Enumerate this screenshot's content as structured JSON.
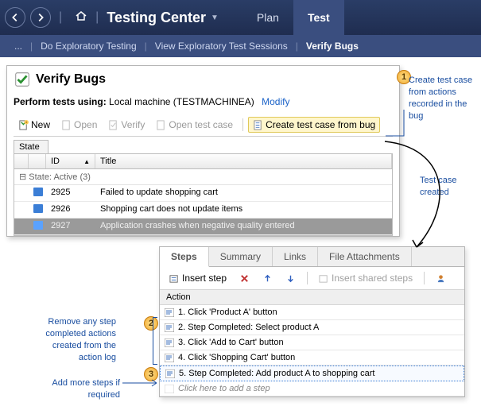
{
  "top": {
    "brand": "Testing Center",
    "tabs": [
      "Plan",
      "Test"
    ],
    "active_tab": 1
  },
  "subnav": {
    "items": [
      "...",
      "Do Exploratory Testing",
      "View Exploratory Test Sessions",
      "Verify Bugs"
    ],
    "active": 3
  },
  "panel": {
    "title": "Verify Bugs",
    "perform_label": "Perform tests using:",
    "perform_value": "Local machine (TESTMACHINEA)",
    "modify": "Modify"
  },
  "toolbar": {
    "new": "New",
    "open": "Open",
    "verify": "Verify",
    "open_test_case": "Open test case",
    "create_from_bug": "Create test case from bug"
  },
  "grid": {
    "state_header": "State",
    "cols": {
      "id": "ID",
      "title": "Title"
    },
    "group": "State: Active (3)",
    "rows": [
      {
        "id": "2925",
        "title": "Failed to update shopping cart"
      },
      {
        "id": "2926",
        "title": "Shopping cart does not update items"
      },
      {
        "id": "2927",
        "title": "Application crashes when negative quality entered"
      }
    ]
  },
  "steps": {
    "tabs": [
      "Steps",
      "Summary",
      "Links",
      "File Attachments"
    ],
    "active_tab": 0,
    "insert_step": "Insert step",
    "insert_shared": "Insert shared steps",
    "action_header": "Action",
    "rows": [
      "1. Click 'Product A' button",
      "2. Step Completed: Select product A",
      "3. Click 'Add to Cart' button",
      "4. Click 'Shopping Cart' button",
      "5. Step Completed: Add product A to shopping cart"
    ],
    "add_hint": "Click here to add a step"
  },
  "callouts": {
    "c1": "Create test case from actions recorded in the bug",
    "c_mid": "Test case created",
    "c2": "Remove any step completed actions created from the action log",
    "c3": "Add more steps if required"
  }
}
